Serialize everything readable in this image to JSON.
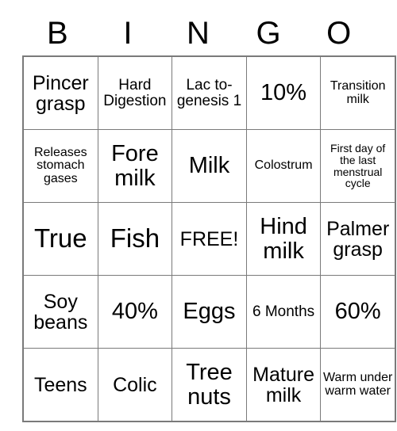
{
  "card": {
    "title_letters": [
      "B",
      "I",
      "N",
      "G",
      "O"
    ],
    "columns": 5,
    "rows": 5,
    "free_space_label": "FREE!",
    "grid_line_color": "#7a7a7a",
    "text_color": "#000000",
    "background_color": "#ffffff",
    "cells": [
      [
        {
          "text": "Pincer grasp",
          "size": "md"
        },
        {
          "text": "Hard Digestion",
          "size": "sm"
        },
        {
          "text": "Lac to-genesis 1",
          "size": "sm"
        },
        {
          "text": "10%",
          "size": "lg"
        },
        {
          "text": "Transition milk",
          "size": "xs"
        }
      ],
      [
        {
          "text": "Releases stomach gases",
          "size": "xs"
        },
        {
          "text": "Fore milk",
          "size": "lg"
        },
        {
          "text": "Milk",
          "size": "lg"
        },
        {
          "text": "Colostrum",
          "size": "xs"
        },
        {
          "text": "First day of the last menstrual cycle",
          "size": "xxs"
        }
      ],
      [
        {
          "text": "True",
          "size": "xl"
        },
        {
          "text": "Fish",
          "size": "xl"
        },
        {
          "text": "FREE!",
          "size": "md"
        },
        {
          "text": "Hind milk",
          "size": "lg"
        },
        {
          "text": "Palmer grasp",
          "size": "md"
        }
      ],
      [
        {
          "text": "Soy beans",
          "size": "md"
        },
        {
          "text": "40%",
          "size": "lg"
        },
        {
          "text": "Eggs",
          "size": "lg"
        },
        {
          "text": "6 Months",
          "size": "sm"
        },
        {
          "text": "60%",
          "size": "lg"
        }
      ],
      [
        {
          "text": "Teens",
          "size": "md"
        },
        {
          "text": "Colic",
          "size": "md"
        },
        {
          "text": "Tree nuts",
          "size": "lg"
        },
        {
          "text": "Mature milk",
          "size": "md"
        },
        {
          "text": "Warm under warm water",
          "size": "xs"
        }
      ]
    ]
  }
}
